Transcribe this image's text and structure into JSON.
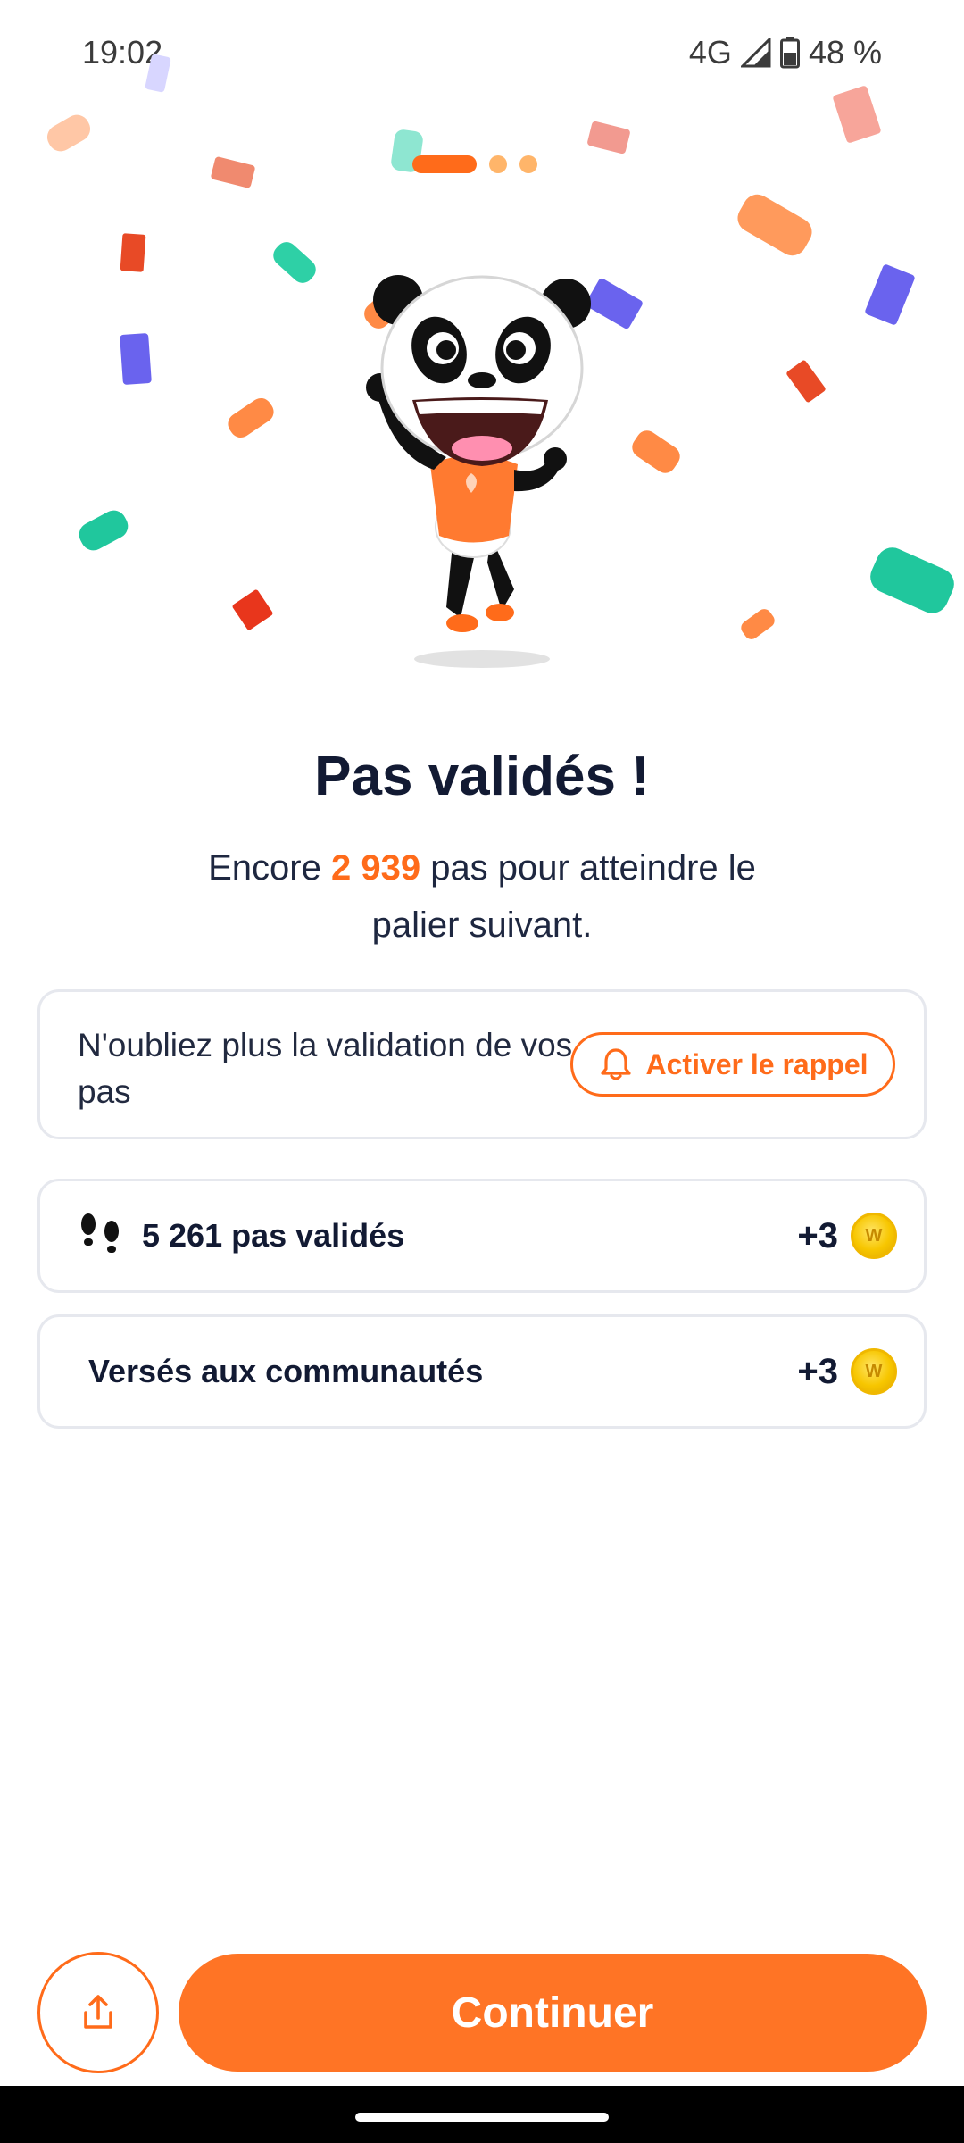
{
  "status_bar": {
    "time": "19:02",
    "network": "4G",
    "battery": "48 %"
  },
  "pager": {
    "pages": 3,
    "active": 1
  },
  "hero": {
    "title": "Pas validés !",
    "subtitle_before": "Encore ",
    "subtitle_highlight": "2 939",
    "subtitle_after": " pas pour atteindre le palier suivant."
  },
  "reminder": {
    "text": "N'oubliez plus la validation de vos pas",
    "button_label": "Activer le rappel",
    "button_icon": "bell-icon"
  },
  "rewards": [
    {
      "label": "5 261 pas validés",
      "value": "+3",
      "icon": "footsteps-icon"
    },
    {
      "label": "Versés aux communautés",
      "value": "+3"
    }
  ],
  "coin_letter": "W",
  "footer": {
    "share_icon": "share-icon",
    "continue_label": "Continuer"
  },
  "colors": {
    "accent": "#ff6b1a",
    "title": "#121a33",
    "coin": "#f7c600"
  }
}
